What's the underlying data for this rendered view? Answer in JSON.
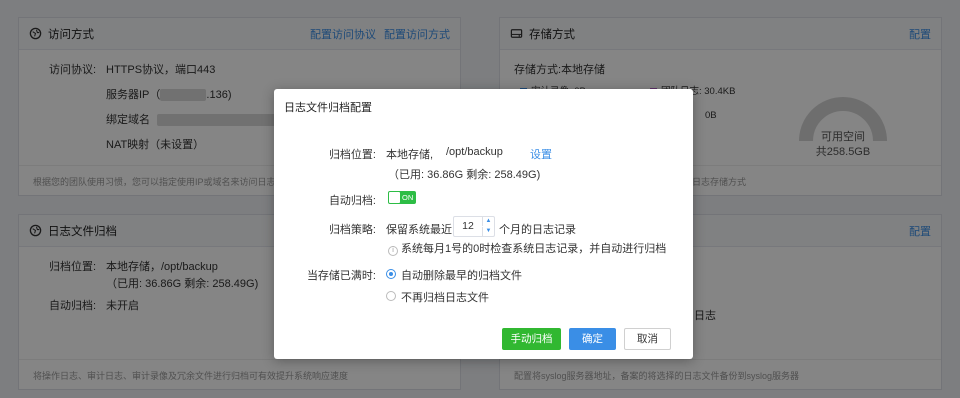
{
  "access_card": {
    "title": "访问方式",
    "link1": "配置访问协议",
    "link2": "配置访问方式",
    "protocol_label": "访问协议:",
    "protocol_value": "HTTPS协议，端口443",
    "server_ip_label": "服务器IP（",
    "server_ip_tail": ".136)",
    "domain_label": "绑定域名",
    "domain_tail": ")",
    "nat_label": "NAT映射（未设置）",
    "footer": "根据您的团队使用习惯，您可以指定使用IP或域名来访问日志服务器"
  },
  "storage_card": {
    "title": "存储方式",
    "config": "配置",
    "mode_label": "存储方式:",
    "mode_value": "本地存储",
    "legend1": "审计录像: 0B",
    "legend2": "团队日志: 30.4KB",
    "legend3": "0B",
    "gauge_label": "可用空间",
    "gauge_value": "共258.5GB",
    "footer": "日志存储方式",
    "accent_blue": "#3a8ee6",
    "accent_purple": "#b25ec8"
  },
  "archive_card": {
    "title": "日志文件归档",
    "location_label": "归档位置:",
    "location_value": "本地存储，/opt/backup",
    "usage": "（已用: 36.86G 剩余: 258.49G)",
    "auto_label": "自动归档:",
    "auto_value": "未开启",
    "footer": "将操作日志、审计日志、审计录像及冗余文件进行归档可有效提升系统响应速度"
  },
  "syslog_card": {
    "config": "配置",
    "mid_text": "日志",
    "footer": "配置将syslog服务器地址，备案的将选择的日志文件备份到syslog服务器"
  },
  "dialog": {
    "title": "日志文件归档配置",
    "location_label": "归档位置:",
    "location_value": "本地存储,",
    "location_path": "/opt/backup",
    "settings_link": "设置",
    "usage": "（已用: 36.86G 剩余: 258.49G)",
    "auto_label": "自动归档:",
    "toggle_text": "ON",
    "policy_label": "归档策略:",
    "policy_prefix": "保留系统最近",
    "policy_months": "12",
    "policy_suffix": "个月的日志记录",
    "policy_note": "系统每月1号的0时检查系统日志记录，并自动进行归档",
    "full_label": "当存储已满时:",
    "option1": "自动删除最早的归档文件",
    "option2": "不再归档日志文件",
    "btn_manual": "手动归档",
    "btn_ok": "确定",
    "btn_cancel": "取消"
  }
}
